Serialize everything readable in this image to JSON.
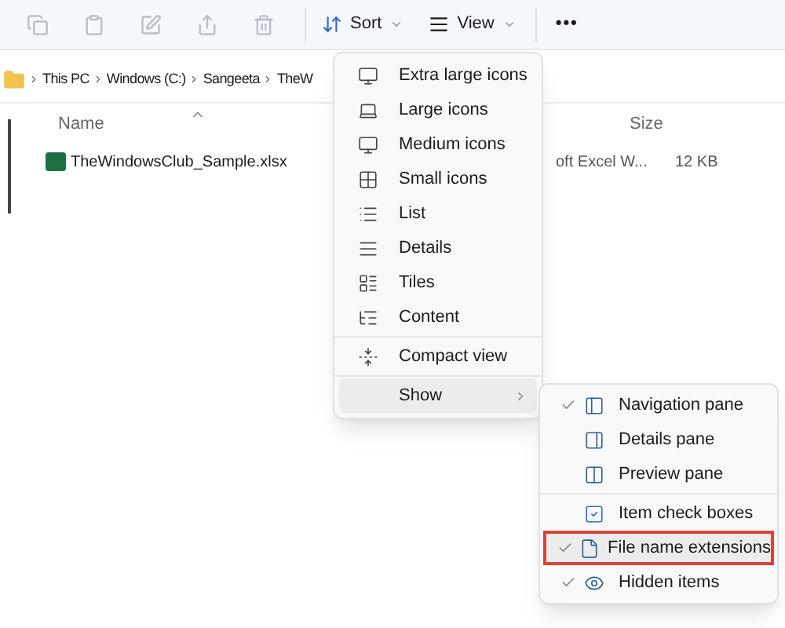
{
  "toolbar": {
    "icon_buttons": [
      {
        "kind": "copy",
        "disabled": true
      },
      {
        "kind": "paste",
        "disabled": true
      },
      {
        "kind": "rename",
        "disabled": true
      },
      {
        "kind": "share",
        "disabled": true
      },
      {
        "kind": "delete",
        "disabled": true
      }
    ],
    "sort": "Sort",
    "view": "View",
    "more": "•••"
  },
  "breadcrumb": [
    "This PC",
    "Windows (C:)",
    "Sangeeta",
    "TheW"
  ],
  "columns": {
    "name": "Name",
    "size": "Size"
  },
  "files": [
    {
      "name": "TheWindowsClub_Sample.xlsx",
      "type": "oft Excel W...",
      "size": "12 KB"
    }
  ],
  "view_menu": {
    "items": [
      {
        "kind": "xl",
        "label": "Extra large icons"
      },
      {
        "kind": "lg",
        "label": "Large icons"
      },
      {
        "kind": "md",
        "label": "Medium icons"
      },
      {
        "kind": "sm",
        "label": "Small icons"
      },
      {
        "kind": "list",
        "label": "List"
      },
      {
        "kind": "details",
        "label": "Details"
      },
      {
        "kind": "tiles",
        "label": "Tiles"
      },
      {
        "kind": "content",
        "label": "Content"
      },
      {
        "kind": "compact",
        "label": "Compact view",
        "separator_before": true
      },
      {
        "kind": "submenu",
        "label": "Show",
        "expanded": true,
        "separator_before": true
      }
    ]
  },
  "show_menu": {
    "items": [
      {
        "kind": "nav",
        "label": "Navigation pane",
        "checked": true,
        "highlighted": false
      },
      {
        "kind": "detailspane",
        "label": "Details pane",
        "checked": false,
        "highlighted": false
      },
      {
        "kind": "preview",
        "label": "Preview pane",
        "checked": false,
        "highlighted": false
      },
      {
        "kind": "checkboxes",
        "label": "Item check boxes",
        "checked": false,
        "highlighted": false,
        "separator_before": true
      },
      {
        "kind": "ext",
        "label": "File name extensions",
        "checked": true,
        "highlighted": true
      },
      {
        "kind": "hidden",
        "label": "Hidden items",
        "checked": true,
        "highlighted": false
      }
    ]
  }
}
